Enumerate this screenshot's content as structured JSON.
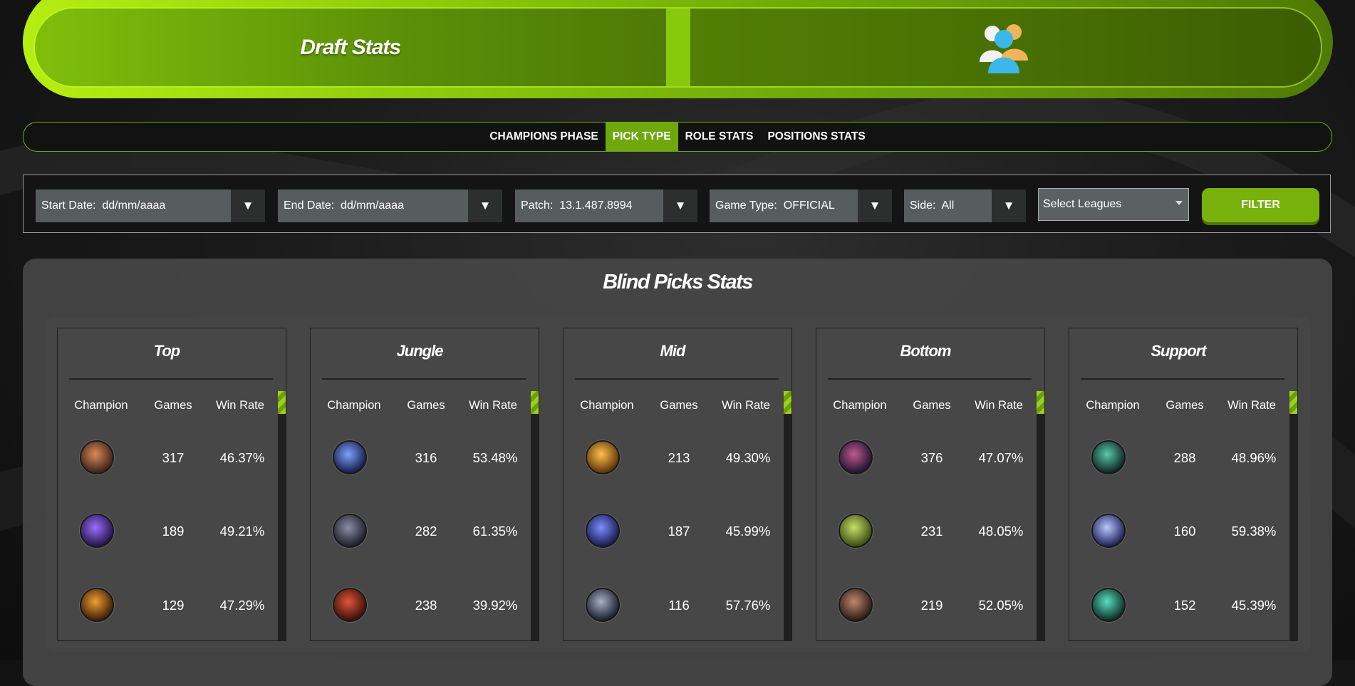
{
  "header": {
    "title": "Draft Stats",
    "icon": "users-icon"
  },
  "tabs": [
    {
      "label": "CHAMPIONS PHASE",
      "active": false
    },
    {
      "label": "PICK TYPE",
      "active": true
    },
    {
      "label": "ROLE STATS",
      "active": false
    },
    {
      "label": "POSITIONS STATS",
      "active": false
    }
  ],
  "filters": {
    "start_date": {
      "label": "Start Date:",
      "value": "dd/mm/aaaa"
    },
    "end_date": {
      "label": "End Date:",
      "value": "dd/mm/aaaa"
    },
    "patch": {
      "label": "Patch:",
      "value": "13.1.487.8994"
    },
    "game_type": {
      "label": "Game Type:",
      "value": "OFFICIAL"
    },
    "side": {
      "label": "Side:",
      "value": "All"
    },
    "leagues": {
      "placeholder": "Select Leagues"
    },
    "filter_button": "FILTER"
  },
  "panel": {
    "title": "Blind Picks Stats",
    "columns": {
      "champion": "Champion",
      "games": "Games",
      "win_rate": "Win Rate"
    },
    "roles": [
      {
        "name": "Top",
        "rows": [
          {
            "games": "317",
            "win_rate": "46.37%",
            "avatar": [
              "#d98b5a",
              "#3a1f14"
            ]
          },
          {
            "games": "189",
            "win_rate": "49.21%",
            "avatar": [
              "#9b6cff",
              "#221446"
            ]
          },
          {
            "games": "129",
            "win_rate": "47.29%",
            "avatar": [
              "#f0a030",
              "#3a1a08"
            ]
          }
        ]
      },
      {
        "name": "Jungle",
        "rows": [
          {
            "games": "316",
            "win_rate": "53.48%",
            "avatar": [
              "#7aa2ff",
              "#141a44"
            ]
          },
          {
            "games": "282",
            "win_rate": "61.35%",
            "avatar": [
              "#8d8da8",
              "#1c1c2a"
            ]
          },
          {
            "games": "238",
            "win_rate": "39.92%",
            "avatar": [
              "#e0553a",
              "#3a0f08"
            ]
          }
        ]
      },
      {
        "name": "Mid",
        "rows": [
          {
            "games": "213",
            "win_rate": "49.30%",
            "avatar": [
              "#ffc24a",
              "#5a3008"
            ]
          },
          {
            "games": "187",
            "win_rate": "45.99%",
            "avatar": [
              "#7c8cff",
              "#161a4a"
            ]
          },
          {
            "games": "116",
            "win_rate": "57.76%",
            "avatar": [
              "#a8b0c8",
              "#181c2a"
            ]
          }
        ]
      },
      {
        "name": "Bottom",
        "rows": [
          {
            "games": "376",
            "win_rate": "47.07%",
            "avatar": [
              "#c05a8a",
              "#1c1430"
            ]
          },
          {
            "games": "231",
            "win_rate": "48.05%",
            "avatar": [
              "#c8e06a",
              "#3a4a10"
            ]
          },
          {
            "games": "219",
            "win_rate": "52.05%",
            "avatar": [
              "#c08870",
              "#2a1812"
            ]
          }
        ]
      },
      {
        "name": "Support",
        "rows": [
          {
            "games": "288",
            "win_rate": "48.96%",
            "avatar": [
              "#5ac8a8",
              "#0c2420"
            ]
          },
          {
            "games": "160",
            "win_rate": "59.38%",
            "avatar": [
              "#b8c8ff",
              "#1a1e54"
            ]
          },
          {
            "games": "152",
            "win_rate": "45.39%",
            "avatar": [
              "#5ae0c0",
              "#0c2a24"
            ]
          }
        ]
      }
    ]
  },
  "colors": {
    "accent": "#79b10c",
    "accent_bright": "#b6ee12",
    "panel": "#474747"
  }
}
